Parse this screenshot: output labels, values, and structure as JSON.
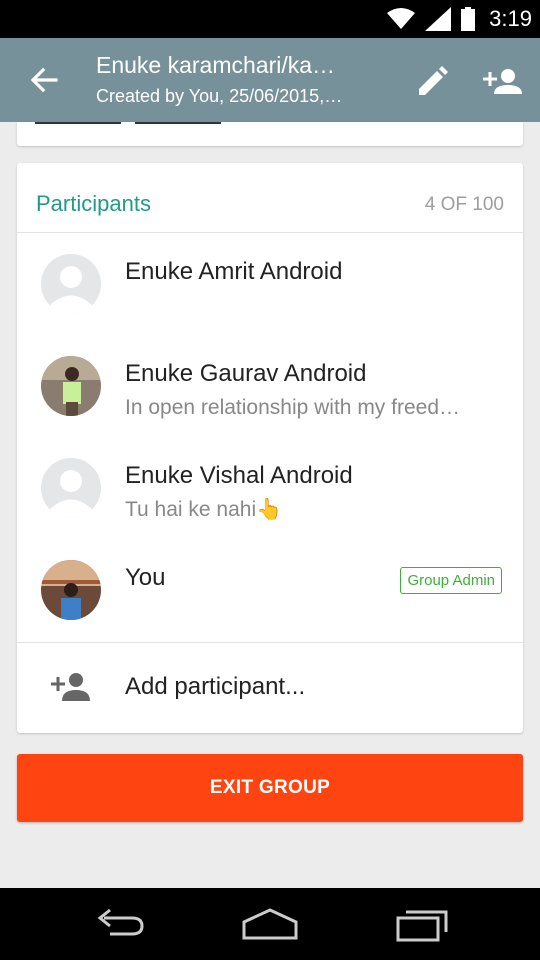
{
  "status_bar": {
    "time": "3:19",
    "icons": [
      "wifi-icon",
      "signal-icon",
      "battery-icon"
    ]
  },
  "header": {
    "title": "Enuke karamchari/ka…",
    "subtitle": "Created by You, 25/06/2015,…",
    "icons": [
      "back-arrow-icon",
      "edit-pencil-icon",
      "add-participant-icon"
    ]
  },
  "participants": {
    "title": "Participants",
    "count": "4 OF 100",
    "items": [
      {
        "name": "Enuke Amrit Android",
        "status": "",
        "avatar": "default-avatar"
      },
      {
        "name": "Enuke Gaurav Android",
        "status": "In open relationship with my freed…",
        "avatar": "photo-avatar"
      },
      {
        "name": "Enuke Vishal Android",
        "status": "Tu hai ke nahi👆",
        "avatar": "default-avatar"
      },
      {
        "name": "You",
        "status": "",
        "badge": "Group Admin",
        "avatar": "photo-avatar"
      }
    ],
    "add_label": "Add participant..."
  },
  "exit_button": {
    "label": "EXIT GROUP"
  },
  "colors": {
    "app_bar": "#77919a",
    "accent_teal": "#1f9b86",
    "admin_green": "#3faf3a",
    "exit_red": "#fd4411"
  },
  "nav_icons": [
    "back-nav-icon",
    "home-nav-icon",
    "recents-nav-icon"
  ]
}
